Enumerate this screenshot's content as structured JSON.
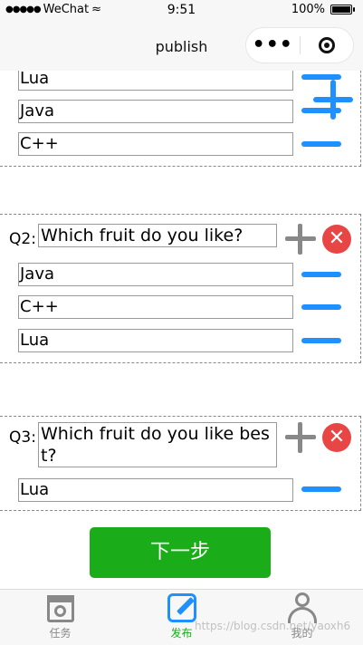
{
  "status_bar": {
    "carrier": "WeChat",
    "time": "9:51",
    "battery": "100%"
  },
  "nav": {
    "title": "publish",
    "more_glyph": "•••"
  },
  "questions": [
    {
      "label": "",
      "title": "",
      "options": [
        "Lua",
        "Java",
        "C++"
      ]
    },
    {
      "label": "Q2:",
      "title": "Which fruit do you like?",
      "options": [
        "Java",
        "C++",
        "Lua"
      ]
    },
    {
      "label": "Q3:",
      "title": "Which fruit do you like best?",
      "options": [
        "Lua"
      ]
    }
  ],
  "close_glyph": "✕",
  "next_button": "下一步",
  "tabs": [
    {
      "label": "任务",
      "icon": "calendar-gear-icon"
    },
    {
      "label": "发布",
      "icon": "edit-icon"
    },
    {
      "label": "我的",
      "icon": "user-icon"
    }
  ],
  "watermark": "https://blog.csdn.net/yaoxh6",
  "colors": {
    "accent_blue": "#1e90ff",
    "primary_green": "#1aad19",
    "delete_red": "#e84545"
  }
}
